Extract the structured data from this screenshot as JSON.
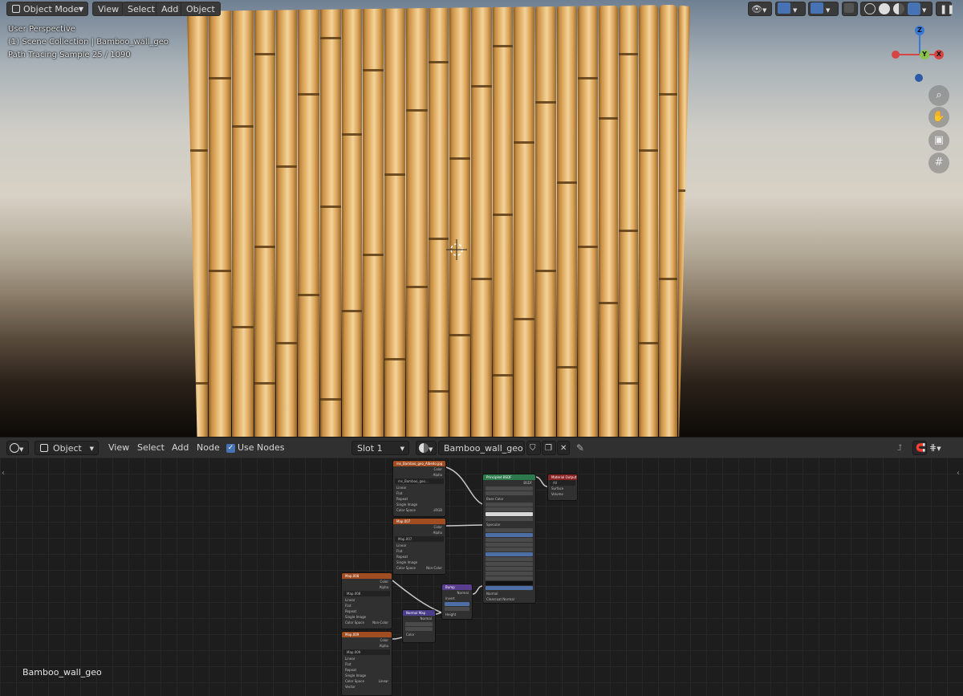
{
  "viewport": {
    "mode_label": "Object Mode",
    "menu": [
      "View",
      "Select",
      "Add",
      "Object"
    ],
    "info_lines": [
      "User Perspective",
      "(1) Scene Collection | Bamboo_wall_geo",
      "Path Tracing Sample 25 / 1090"
    ],
    "gizmo": {
      "z": "Z",
      "y": "Y",
      "x": "X"
    }
  },
  "node_editor": {
    "editor_icon": "shader-editor-icon",
    "object_label": "Object",
    "menu": [
      "View",
      "Select",
      "Add",
      "Node"
    ],
    "use_nodes_label": "Use Nodes",
    "use_nodes_checked": true,
    "slot_label": "Slot 1",
    "material_name": "Bamboo_wall_geo",
    "overlay_object_name": "Bamboo_wall_geo",
    "nodes": {
      "tex1": {
        "title": "ms_Bamboo_geo_Albedo.jpg",
        "image": "ms_Bamboo_geo...",
        "rows": [
          "Linear",
          "Flat",
          "Repeat",
          "Single Image",
          "Color Space",
          "Alpha",
          "Vector"
        ],
        "outputs": [
          "Color",
          "Alpha"
        ],
        "color_space": "sRGB"
      },
      "tex2": {
        "title": "Map.007",
        "image": "Map.007",
        "rows": [
          "Linear",
          "Flat",
          "Repeat",
          "Single Image",
          "Color Space",
          "Alpha",
          "Vector"
        ],
        "outputs": [
          "Color",
          "Alpha"
        ],
        "color_space": "Non-Color"
      },
      "tex3": {
        "title": "Map.008",
        "image": "Map.008",
        "rows": [
          "Linear",
          "Flat",
          "Repeat",
          "Single Image",
          "Color Space",
          "Alpha",
          "Vector"
        ],
        "outputs": [
          "Color",
          "Alpha"
        ],
        "color_space": "Non-Color"
      },
      "tex4": {
        "title": "Map.009",
        "image": "Map.009",
        "rows": [
          "Linear",
          "Flat",
          "Repeat",
          "Single Image",
          "Color Space",
          "Alpha",
          "Vector"
        ],
        "outputs": [
          "Color",
          "Alpha"
        ],
        "color_space": "Linear"
      },
      "bsdf": {
        "title": "Principled BSDF",
        "rows": [
          "GGX",
          "Random Walk",
          "Base Color",
          "Subsurface",
          "Subsurface Radius",
          "Subsurface Color",
          "Metallic",
          "Specular",
          "Specular Tint",
          "Roughness",
          "Anisotropic",
          "Anisotropic Rotation",
          "Sheen",
          "Sheen Tint",
          "Clearcoat",
          "Clearcoat Roughness",
          "IOR",
          "Transmission",
          "Transmission Roughness",
          "Emission",
          "Alpha",
          "Normal",
          "Clearcoat Normal",
          "Tangent"
        ],
        "output": "BSDF"
      },
      "output": {
        "title": "Material Output",
        "rows": [
          "All",
          "Surface",
          "Volume",
          "Displacement"
        ]
      },
      "bump": {
        "title": "Bump",
        "rows": [
          "Normal",
          "Invert",
          "Strength",
          "Distance",
          "Height",
          "Normal"
        ]
      },
      "normalmap": {
        "title": "Normal Map",
        "rows": [
          "Normal",
          "Tangent Space",
          "UVMap",
          "Strength",
          "Color"
        ]
      }
    }
  },
  "colors": {
    "node_texture": "#a14d22",
    "node_shader": "#2c7a4b",
    "node_output": "#8a2323",
    "node_vector": "#5b3d8f",
    "accent": "#4772b3"
  }
}
